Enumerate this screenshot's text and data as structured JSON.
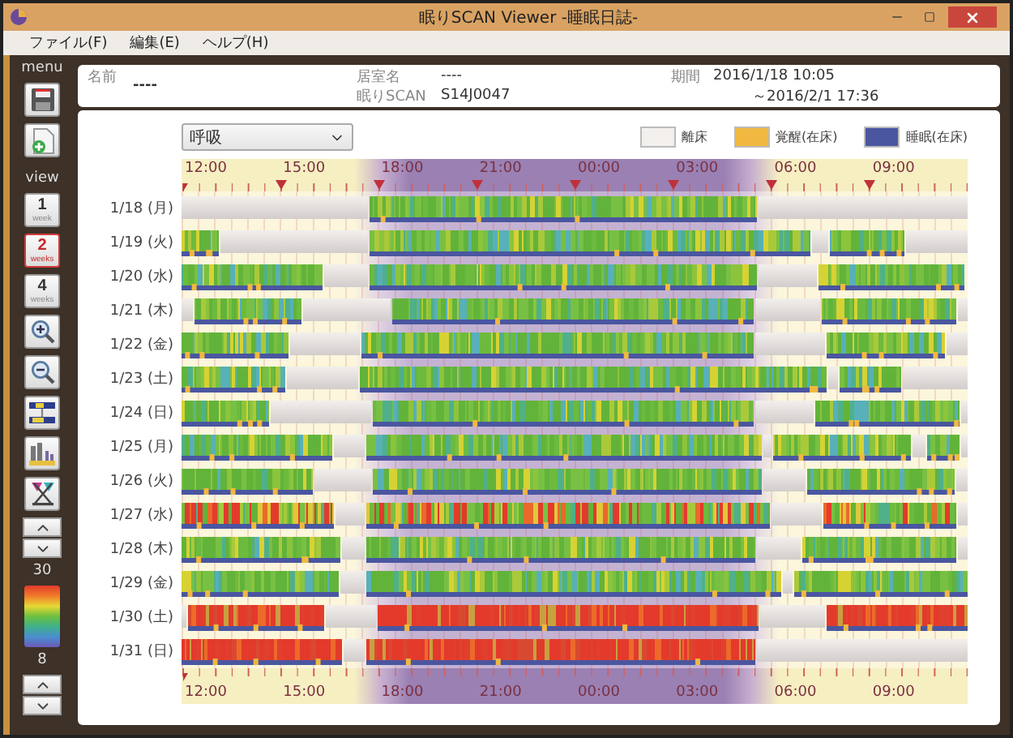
{
  "window": {
    "title": "眠りSCAN Viewer -睡眠日誌-"
  },
  "menu_bar": [
    "ファイル(F)",
    "編集(E)",
    "ヘルプ(H)"
  ],
  "sidebar": {
    "menu_label": "menu",
    "view_label": "view",
    "views": [
      {
        "number": "1",
        "unit": "week",
        "selected": false
      },
      {
        "number": "2",
        "unit": "weeks",
        "selected": true
      },
      {
        "number": "4",
        "unit": "weeks",
        "selected": false
      }
    ],
    "scale_max": "30",
    "scale_min": "8"
  },
  "header": {
    "name_label": "名前",
    "name": "----",
    "room_label": "居室名",
    "room": "----",
    "device_label": "眠りSCAN",
    "device": "S14J0047",
    "period_label": "期間",
    "period_start": "2016/1/18 10:05",
    "period_end": "～2016/2/1 17:36"
  },
  "chart": {
    "metric": "呼吸",
    "legend": [
      {
        "label": "離床",
        "color": "#f2efec"
      },
      {
        "label": "覚醒(在床)",
        "color": "#f0b840"
      },
      {
        "label": "睡眠(在床)",
        "color": "#4a56a0"
      }
    ],
    "axis_top": [
      "12:00",
      "15:00",
      "18:00",
      "21:00",
      "00:00",
      "03:00",
      "06:00",
      "09:00"
    ],
    "rows": [
      {
        "date": "1/18 (月)",
        "kind": "normal"
      },
      {
        "date": "1/19 (火)",
        "kind": "normal"
      },
      {
        "date": "1/20 (水)",
        "kind": "normal"
      },
      {
        "date": "1/21 (木)",
        "kind": "normal"
      },
      {
        "date": "1/22 (金)",
        "kind": "normal"
      },
      {
        "date": "1/23 (土)",
        "kind": "normal"
      },
      {
        "date": "1/24 (日)",
        "kind": "normal"
      },
      {
        "date": "1/25 (月)",
        "kind": "normal"
      },
      {
        "date": "1/26 (火)",
        "kind": "normal"
      },
      {
        "date": "1/27 (水)",
        "kind": "mixed"
      },
      {
        "date": "1/28 (木)",
        "kind": "normal"
      },
      {
        "date": "1/29 (金)",
        "kind": "normal"
      },
      {
        "date": "1/30 (土)",
        "kind": "high"
      },
      {
        "date": "1/31 (日)",
        "kind": "high"
      }
    ],
    "axis_bottom": [
      "12:00",
      "15:00",
      "18:00",
      "21:00",
      "00:00",
      "03:00",
      "06:00",
      "09:00"
    ]
  }
}
